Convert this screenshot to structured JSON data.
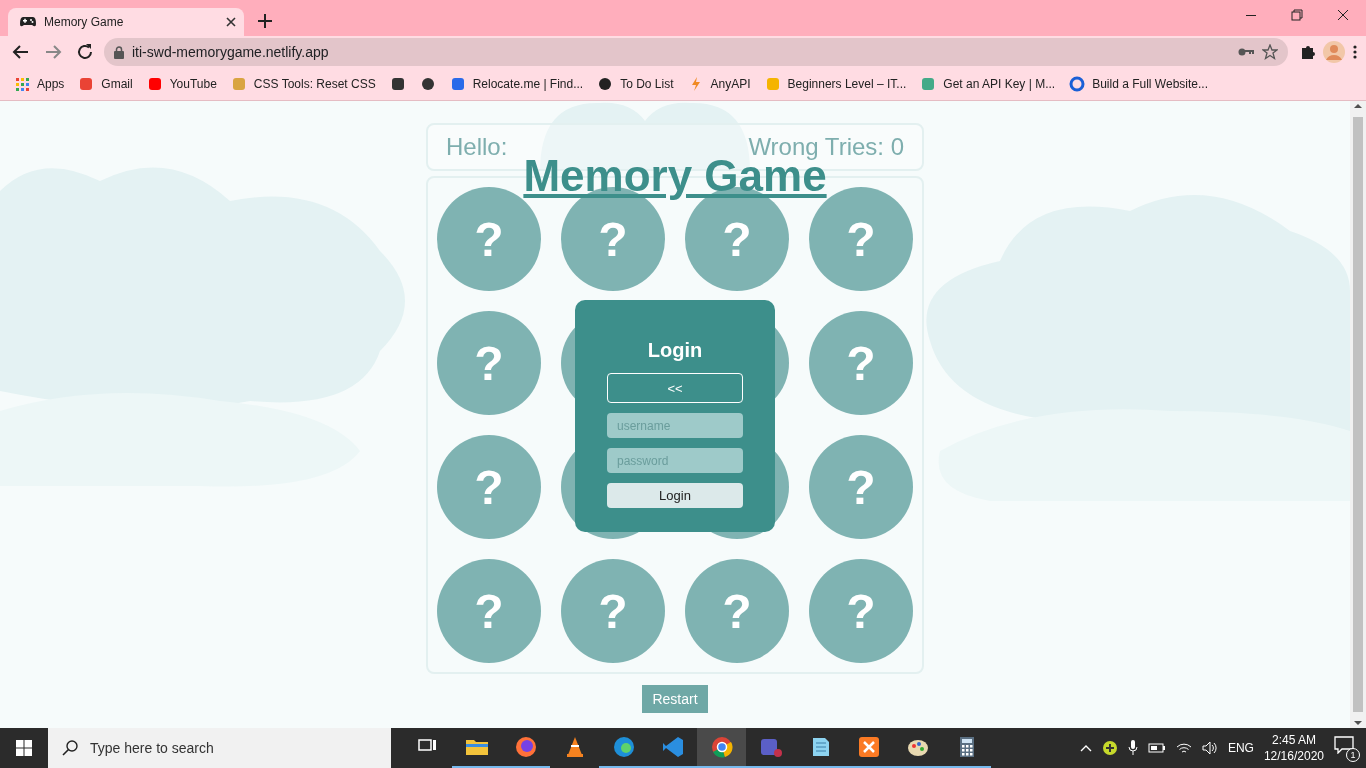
{
  "browser": {
    "tabs": [
      {
        "title": "Memory Game",
        "selected": true
      }
    ],
    "address": "iti-swd-memorygame.netlify.app",
    "bookmarks": [
      {
        "kind": "link",
        "label": "Apps"
      },
      {
        "kind": "link",
        "label": "Gmail"
      },
      {
        "kind": "link",
        "label": "YouTube"
      },
      {
        "kind": "link",
        "label": "CSS Tools: Reset CSS"
      },
      {
        "kind": "icon"
      },
      {
        "kind": "icon"
      },
      {
        "kind": "link",
        "label": "Relocate.me | Find..."
      },
      {
        "kind": "link",
        "label": "To Do List"
      },
      {
        "kind": "link",
        "label": "AnyAPI"
      },
      {
        "kind": "link",
        "label": "Beginners Level – IT..."
      },
      {
        "kind": "link",
        "label": "Get an API Key  |  M..."
      },
      {
        "kind": "link",
        "label": "Build a Full Website..."
      }
    ]
  },
  "page": {
    "header": {
      "greeting": "Hello:",
      "tries": "Wrong Tries: 0"
    },
    "title": "Memory Game",
    "card_rows": [
      {
        "cards": [
          {
            "label": "?"
          },
          {
            "label": "?"
          },
          {
            "label": "?"
          },
          {
            "label": "?"
          }
        ]
      },
      {
        "cards": [
          {
            "label": "?"
          },
          {
            "label": "?"
          }
        ]
      },
      {
        "cards": [
          {
            "label": "?"
          },
          {
            "label": "?"
          }
        ]
      },
      {
        "cards": [
          {
            "label": "?"
          },
          {
            "label": "?"
          },
          {
            "label": "?"
          },
          {
            "label": "?"
          }
        ]
      }
    ],
    "login": {
      "title": "Login",
      "back": "<<",
      "username_placeholder": "username",
      "password_placeholder": "password",
      "submit": "Login"
    },
    "restart": "Restart"
  },
  "taskbar": {
    "search_placeholder": "Type here to search",
    "apps": [
      {
        "running": false,
        "selected": false
      },
      {
        "running": true,
        "selected": false
      },
      {
        "running": true,
        "selected": false
      },
      {
        "running": false,
        "selected": false
      },
      {
        "running": true,
        "selected": false
      },
      {
        "running": true,
        "selected": false
      },
      {
        "running": true,
        "selected": true
      },
      {
        "running": true,
        "selected": false
      },
      {
        "running": true,
        "selected": false
      },
      {
        "running": true,
        "selected": false
      },
      {
        "running": true,
        "selected": false
      },
      {
        "running": true,
        "selected": false
      }
    ],
    "language": "ENG",
    "time": "2:45 AM",
    "date": "12/16/2020",
    "notifications": "1"
  }
}
